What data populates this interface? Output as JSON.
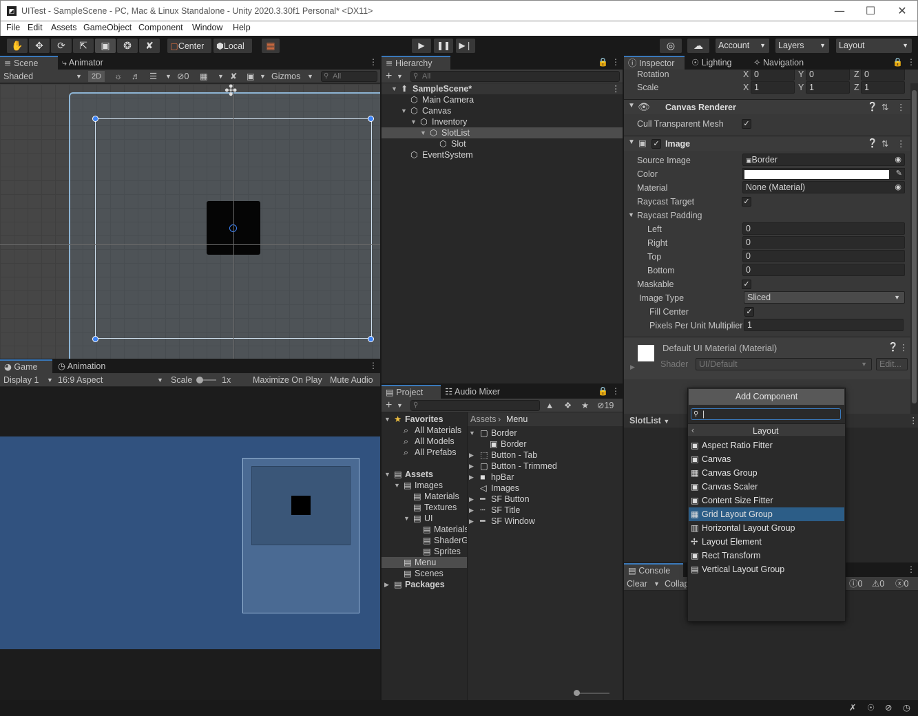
{
  "window": {
    "title": "UITest - SampleScene - PC, Mac & Linux Standalone - Unity 2020.3.30f1 Personal* <DX11>",
    "app_icon": "◩"
  },
  "menu": [
    "File",
    "Edit",
    "Assets",
    "GameObject",
    "Component",
    "Window",
    "Help"
  ],
  "toolbar": {
    "tools": [
      "hand-icon",
      "move-icon",
      "rotate-icon",
      "scale-icon",
      "rect-icon",
      "transform-icon",
      "custom-tool-icon"
    ],
    "pivot": "Center",
    "space": "Local",
    "account": "Account",
    "layers": "Layers",
    "layout": "Layout"
  },
  "scene": {
    "tabs": [
      "Scene",
      "Animator"
    ],
    "shading": "Shaded",
    "mode_2d": "2D",
    "hidden_count": "0",
    "gizmos": "Gizmos",
    "search_placeholder": "All"
  },
  "game": {
    "tabs": [
      "Game",
      "Animation"
    ],
    "display": "Display 1",
    "aspect": "16:9 Aspect",
    "scale_label": "Scale",
    "scale_value": "1x",
    "maximize": "Maximize On Play",
    "mute": "Mute Audio"
  },
  "hierarchy": {
    "title": "Hierarchy",
    "search_placeholder": "All",
    "items": [
      {
        "label": "SampleScene*",
        "indent": 0,
        "arrow": "▼",
        "scene": true
      },
      {
        "label": "Main Camera",
        "indent": 1,
        "arrow": ""
      },
      {
        "label": "Canvas",
        "indent": 1,
        "arrow": "▼"
      },
      {
        "label": "Inventory",
        "indent": 2,
        "arrow": "▼"
      },
      {
        "label": "SlotList",
        "indent": 3,
        "arrow": "▼",
        "selected": true
      },
      {
        "label": "Slot",
        "indent": 4,
        "arrow": ""
      },
      {
        "label": "EventSystem",
        "indent": 1,
        "arrow": ""
      }
    ]
  },
  "project": {
    "tabs": [
      "Project",
      "Audio Mixer"
    ],
    "hidden_count": "19",
    "tree": [
      {
        "label": "Favorites",
        "bold": true,
        "indent": 0,
        "arrow": "▼",
        "icon": "★"
      },
      {
        "label": "All Materials",
        "indent": 1,
        "icon": "⌕"
      },
      {
        "label": "All Models",
        "indent": 1,
        "icon": "⌕"
      },
      {
        "label": "All Prefabs",
        "indent": 1,
        "icon": "⌕"
      },
      {
        "label": "",
        "indent": 0,
        "icon": ""
      },
      {
        "label": "Assets",
        "bold": true,
        "indent": 0,
        "arrow": "▼",
        "icon": "▤"
      },
      {
        "label": "Images",
        "indent": 1,
        "arrow": "▼",
        "icon": "▤"
      },
      {
        "label": "Materials",
        "indent": 2,
        "icon": "▤"
      },
      {
        "label": "Textures",
        "indent": 2,
        "icon": "▤"
      },
      {
        "label": "UI",
        "indent": 2,
        "arrow": "▼",
        "icon": "▤"
      },
      {
        "label": "Materials",
        "indent": 3,
        "icon": "▤"
      },
      {
        "label": "ShaderG",
        "indent": 3,
        "icon": "▤"
      },
      {
        "label": "Sprites",
        "indent": 3,
        "icon": "▤"
      },
      {
        "label": "Menu",
        "indent": 1,
        "icon": "▤",
        "selected": true
      },
      {
        "label": "Scenes",
        "indent": 1,
        "icon": "▤"
      },
      {
        "label": "Packages",
        "bold": true,
        "indent": 0,
        "arrow": "▶",
        "icon": "▤"
      }
    ],
    "breadcrumb": [
      "Assets",
      "Menu"
    ],
    "files": [
      {
        "label": "Border",
        "arrow": "▼",
        "icon": "▢",
        "indent": 0
      },
      {
        "label": "Border",
        "icon": "▣",
        "indent": 1
      },
      {
        "label": "Button - Tab",
        "arrow": "▶",
        "icon": "⬚",
        "indent": 0
      },
      {
        "label": "Button - Trimmed",
        "arrow": "▶",
        "icon": "▢",
        "indent": 0
      },
      {
        "label": "hpBar",
        "arrow": "▶",
        "icon": "■",
        "indent": 0
      },
      {
        "label": "Images",
        "icon": "◁",
        "indent": 0
      },
      {
        "label": "SF Button",
        "arrow": "▶",
        "icon": "━",
        "indent": 0
      },
      {
        "label": "SF Title",
        "arrow": "▶",
        "icon": "┄",
        "indent": 0
      },
      {
        "label": "SF Window",
        "arrow": "▶",
        "icon": "━",
        "indent": 0
      }
    ]
  },
  "inspector": {
    "tabs": [
      "Inspector",
      "Lighting",
      "Navigation"
    ],
    "rotation": {
      "label": "Rotation",
      "x": "0",
      "y": "0",
      "z": "0"
    },
    "scale": {
      "label": "Scale",
      "x": "1",
      "y": "1",
      "z": "1"
    },
    "canvas_renderer": {
      "title": "Canvas Renderer",
      "cull_label": "Cull Transparent Mesh"
    },
    "image": {
      "title": "Image",
      "source_image_label": "Source Image",
      "source_image_value": "Border",
      "color_label": "Color",
      "material_label": "Material",
      "material_value": "None (Material)",
      "raycast_target_label": "Raycast Target",
      "raycast_padding_label": "Raycast Padding",
      "left_label": "Left",
      "left": "0",
      "right_label": "Right",
      "right": "0",
      "top_label": "Top",
      "top": "0",
      "bottom_label": "Bottom",
      "bottom": "0",
      "maskable_label": "Maskable",
      "image_type_label": "Image Type",
      "image_type_value": "Sliced",
      "fill_center_label": "Fill Center",
      "ppu_label": "Pixels Per Unit Multiplier",
      "ppu_value": "1"
    },
    "material": {
      "title": "Default UI Material (Material)",
      "shader_label": "Shader",
      "shader_value": "UI/Default",
      "edit": "Edit..."
    },
    "preview_dropdown": "SlotList"
  },
  "add_component": {
    "button": "Add Component",
    "search_value": "|",
    "category": "Layout",
    "items": [
      {
        "label": "Aspect Ratio Fitter",
        "icon": "▣"
      },
      {
        "label": "Canvas",
        "icon": "▣"
      },
      {
        "label": "Canvas Group",
        "icon": "▦"
      },
      {
        "label": "Canvas Scaler",
        "icon": "▣"
      },
      {
        "label": "Content Size Fitter",
        "icon": "▣"
      },
      {
        "label": "Grid Layout Group",
        "icon": "▦",
        "selected": true
      },
      {
        "label": "Horizontal Layout Group",
        "icon": "▥"
      },
      {
        "label": "Layout Element",
        "icon": "✢"
      },
      {
        "label": "Rect Transform",
        "icon": "▣"
      },
      {
        "label": "Vertical Layout Group",
        "icon": "▤"
      }
    ]
  },
  "console": {
    "tab": "Console",
    "clear": "Clear",
    "collapse": "Collap",
    "info_count": "0",
    "warn_count": "0",
    "error_count": "0"
  },
  "colors": {
    "accent": "#3a79bb",
    "selection": "#2c5d87",
    "panel": "#282828",
    "header": "#3c3c3c",
    "game_bg": "#31527f"
  }
}
